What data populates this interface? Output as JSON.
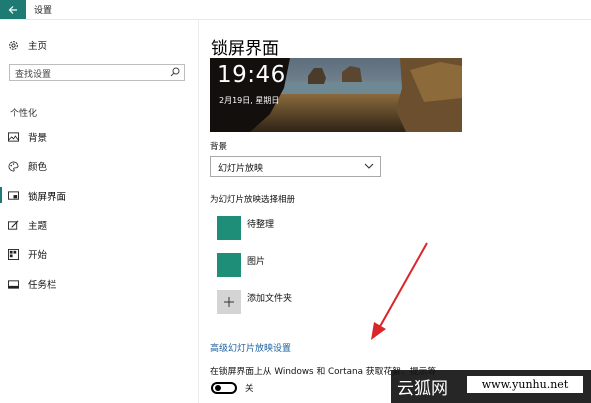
{
  "window": {
    "title": "设置"
  },
  "sidebar": {
    "home_label": "主页",
    "search_placeholder": "查找设置",
    "section": "个性化",
    "items": [
      {
        "label": "背景",
        "icon": "picture-icon"
      },
      {
        "label": "颜色",
        "icon": "palette-icon"
      },
      {
        "label": "锁屏界面",
        "icon": "lock-screen-icon",
        "active": true
      },
      {
        "label": "主题",
        "icon": "brush-icon"
      },
      {
        "label": "开始",
        "icon": "start-icon"
      },
      {
        "label": "任务栏",
        "icon": "taskbar-icon"
      }
    ]
  },
  "main": {
    "title": "锁屏界面",
    "preview": {
      "time": "19:46",
      "date": "2月19日, 星期日"
    },
    "background_label": "背景",
    "background_value": "幻灯片放映",
    "album_header": "为幻灯片放映选择相册",
    "albums": [
      "待整理",
      "图片"
    ],
    "add_folder": "添加文件夹",
    "advanced_link": "高级幻灯片放映设置",
    "cortana_text": "在锁屏界面上从 Windows 和 Cortana 获取花絮、提示等",
    "toggle_state": "关"
  },
  "watermark": {
    "name": "云狐网",
    "url": "www.yunhu.net"
  },
  "colors": {
    "accent": "#1e7b73",
    "album_tile": "#1e8e79",
    "link": "#1a5f9e"
  }
}
